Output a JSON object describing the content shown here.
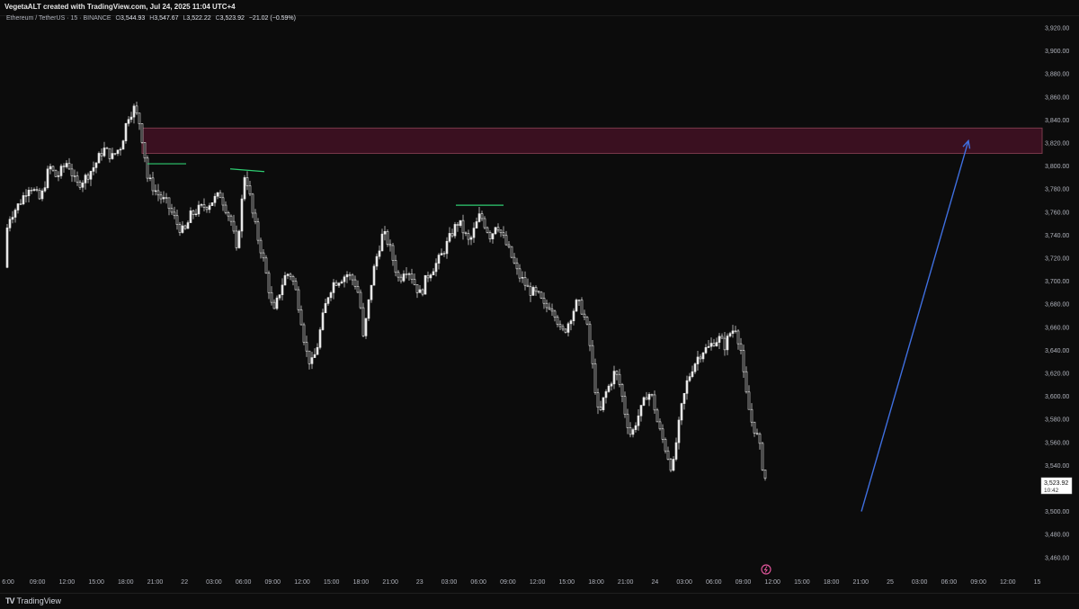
{
  "header": {
    "attribution": "VegetaALT created with TradingView.com, Jul 24, 2025 11:04 UTC+4"
  },
  "legend": {
    "symbol": "Ethereum / TetherUS · 15 · BINANCE",
    "o_label": "O",
    "o_value": "3,544.93",
    "h_label": "H",
    "h_value": "3,547.67",
    "l_label": "L",
    "l_value": "3,522.22",
    "c_label": "C",
    "c_value": "3,523.92",
    "change": "−21.02 (−0.59%)"
  },
  "footer": {
    "brand": "TradingView",
    "logo": "TV"
  },
  "price_tag": {
    "price": "3,523.92",
    "countdown": "10:42"
  },
  "colors": {
    "background": "#0c0c0c",
    "candle": "#e8e8e8",
    "zone_fill": "#3a1020",
    "zone_border": "#7a3a4a",
    "level_lines": "#2ecc71",
    "arrow": "#3f6fe0",
    "alert_icon": "#e0559a"
  },
  "chart_data": {
    "type": "candlestick",
    "y_ticks": [
      "3,920.00",
      "3,900.00",
      "3,880.00",
      "3,860.00",
      "3,840.00",
      "3,820.00",
      "3,800.00",
      "3,780.00",
      "3,760.00",
      "3,740.00",
      "3,720.00",
      "3,700.00",
      "3,680.00",
      "3,660.00",
      "3,640.00",
      "3,620.00",
      "3,600.00",
      "3,580.00",
      "3,560.00",
      "3,540.00",
      "3,520.00",
      "3,500.00",
      "3,480.00",
      "3,460.00"
    ],
    "x_ticks": [
      "6:00",
      "09:00",
      "12:00",
      "15:00",
      "18:00",
      "21:00",
      "22",
      "03:00",
      "06:00",
      "09:00",
      "12:00",
      "15:00",
      "18:00",
      "21:00",
      "23",
      "03:00",
      "06:00",
      "09:00",
      "12:00",
      "15:00",
      "18:00",
      "21:00",
      "24",
      "03:00",
      "06:00",
      "09:00",
      "12:00",
      "15:00",
      "18:00",
      "21:00",
      "25",
      "03:00",
      "06:00",
      "09:00",
      "12:00",
      "15"
    ],
    "ylim": [
      3455,
      3930
    ],
    "price_path": [
      [
        0,
        3712
      ],
      [
        10,
        3755
      ],
      [
        22,
        3768
      ],
      [
        33,
        3784
      ],
      [
        45,
        3770
      ],
      [
        55,
        3800
      ],
      [
        63,
        3790
      ],
      [
        75,
        3804
      ],
      [
        85,
        3783
      ],
      [
        95,
        3790
      ],
      [
        105,
        3800
      ],
      [
        115,
        3815
      ],
      [
        125,
        3808
      ],
      [
        135,
        3818
      ],
      [
        142,
        3843
      ],
      [
        149,
        3850
      ],
      [
        155,
        3838
      ],
      [
        160,
        3815
      ],
      [
        164,
        3790
      ],
      [
        170,
        3782
      ],
      [
        178,
        3773
      ],
      [
        185,
        3768
      ],
      [
        192,
        3758
      ],
      [
        198,
        3748
      ],
      [
        205,
        3742
      ],
      [
        212,
        3757
      ],
      [
        220,
        3762
      ],
      [
        230,
        3766
      ],
      [
        238,
        3771
      ],
      [
        245,
        3775
      ],
      [
        252,
        3762
      ],
      [
        258,
        3750
      ],
      [
        263,
        3725
      ],
      [
        268,
        3762
      ],
      [
        272,
        3792
      ],
      [
        276,
        3784
      ],
      [
        280,
        3762
      ],
      [
        286,
        3740
      ],
      [
        292,
        3722
      ],
      [
        298,
        3698
      ],
      [
        304,
        3670
      ],
      [
        310,
        3688
      ],
      [
        316,
        3703
      ],
      [
        322,
        3708
      ],
      [
        328,
        3695
      ],
      [
        334,
        3672
      ],
      [
        340,
        3640
      ],
      [
        346,
        3627
      ],
      [
        352,
        3640
      ],
      [
        358,
        3665
      ],
      [
        364,
        3686
      ],
      [
        370,
        3698
      ],
      [
        378,
        3702
      ],
      [
        386,
        3706
      ],
      [
        394,
        3700
      ],
      [
        400,
        3686
      ],
      [
        404,
        3650
      ],
      [
        409,
        3676
      ],
      [
        414,
        3704
      ],
      [
        420,
        3725
      ],
      [
        426,
        3742
      ],
      [
        432,
        3733
      ],
      [
        438,
        3716
      ],
      [
        444,
        3700
      ],
      [
        450,
        3712
      ],
      [
        456,
        3708
      ],
      [
        462,
        3696
      ],
      [
        468,
        3688
      ],
      [
        474,
        3703
      ],
      [
        480,
        3710
      ],
      [
        486,
        3716
      ],
      [
        492,
        3724
      ],
      [
        498,
        3734
      ],
      [
        504,
        3744
      ],
      [
        510,
        3752
      ],
      [
        516,
        3742
      ],
      [
        522,
        3733
      ],
      [
        528,
        3746
      ],
      [
        534,
        3758
      ],
      [
        540,
        3748
      ],
      [
        546,
        3738
      ],
      [
        552,
        3752
      ],
      [
        558,
        3740
      ],
      [
        564,
        3730
      ],
      [
        570,
        3719
      ],
      [
        576,
        3706
      ],
      [
        582,
        3700
      ],
      [
        588,
        3692
      ],
      [
        594,
        3690
      ],
      [
        600,
        3686
      ],
      [
        606,
        3676
      ],
      [
        612,
        3680
      ],
      [
        618,
        3672
      ],
      [
        624,
        3654
      ],
      [
        630,
        3660
      ],
      [
        636,
        3672
      ],
      [
        642,
        3682
      ],
      [
        648,
        3674
      ],
      [
        654,
        3656
      ],
      [
        660,
        3620
      ],
      [
        666,
        3580
      ],
      [
        672,
        3600
      ],
      [
        678,
        3610
      ],
      [
        684,
        3622
      ],
      [
        690,
        3608
      ],
      [
        696,
        3582
      ],
      [
        702,
        3565
      ],
      [
        708,
        3580
      ],
      [
        714,
        3590
      ],
      [
        720,
        3604
      ],
      [
        726,
        3598
      ],
      [
        732,
        3574
      ],
      [
        738,
        3560
      ],
      [
        744,
        3545
      ],
      [
        748,
        3535
      ],
      [
        752,
        3560
      ],
      [
        758,
        3590
      ],
      [
        764,
        3612
      ],
      [
        770,
        3625
      ],
      [
        776,
        3634
      ],
      [
        782,
        3640
      ],
      [
        788,
        3642
      ],
      [
        794,
        3648
      ],
      [
        800,
        3650
      ],
      [
        806,
        3644
      ],
      [
        812,
        3655
      ],
      [
        818,
        3660
      ],
      [
        824,
        3640
      ],
      [
        828,
        3610
      ],
      [
        832,
        3592
      ],
      [
        836,
        3578
      ],
      [
        840,
        3570
      ],
      [
        844,
        3560
      ],
      [
        848,
        3540
      ],
      [
        852,
        3525
      ]
    ],
    "annotations": [
      {
        "type": "zone",
        "price_top": 3833,
        "price_bottom": 3811
      },
      {
        "type": "level",
        "price": 3802
      },
      {
        "type": "level",
        "price": 3796
      },
      {
        "type": "level",
        "price": 3766
      },
      {
        "type": "arrow",
        "from_price": 3500,
        "to_price": 3822
      }
    ]
  }
}
